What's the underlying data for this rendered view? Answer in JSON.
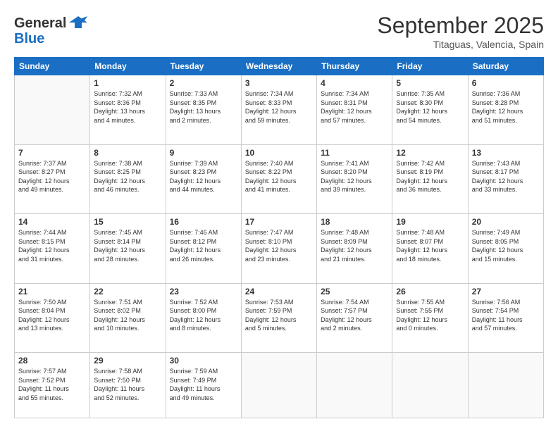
{
  "header": {
    "logo_general": "General",
    "logo_blue": "Blue",
    "month": "September 2025",
    "location": "Titaguas, Valencia, Spain"
  },
  "weekdays": [
    "Sunday",
    "Monday",
    "Tuesday",
    "Wednesday",
    "Thursday",
    "Friday",
    "Saturday"
  ],
  "weeks": [
    [
      {
        "day": "",
        "info": ""
      },
      {
        "day": "1",
        "info": "Sunrise: 7:32 AM\nSunset: 8:36 PM\nDaylight: 13 hours\nand 4 minutes."
      },
      {
        "day": "2",
        "info": "Sunrise: 7:33 AM\nSunset: 8:35 PM\nDaylight: 13 hours\nand 2 minutes."
      },
      {
        "day": "3",
        "info": "Sunrise: 7:34 AM\nSunset: 8:33 PM\nDaylight: 12 hours\nand 59 minutes."
      },
      {
        "day": "4",
        "info": "Sunrise: 7:34 AM\nSunset: 8:31 PM\nDaylight: 12 hours\nand 57 minutes."
      },
      {
        "day": "5",
        "info": "Sunrise: 7:35 AM\nSunset: 8:30 PM\nDaylight: 12 hours\nand 54 minutes."
      },
      {
        "day": "6",
        "info": "Sunrise: 7:36 AM\nSunset: 8:28 PM\nDaylight: 12 hours\nand 51 minutes."
      }
    ],
    [
      {
        "day": "7",
        "info": "Sunrise: 7:37 AM\nSunset: 8:27 PM\nDaylight: 12 hours\nand 49 minutes."
      },
      {
        "day": "8",
        "info": "Sunrise: 7:38 AM\nSunset: 8:25 PM\nDaylight: 12 hours\nand 46 minutes."
      },
      {
        "day": "9",
        "info": "Sunrise: 7:39 AM\nSunset: 8:23 PM\nDaylight: 12 hours\nand 44 minutes."
      },
      {
        "day": "10",
        "info": "Sunrise: 7:40 AM\nSunset: 8:22 PM\nDaylight: 12 hours\nand 41 minutes."
      },
      {
        "day": "11",
        "info": "Sunrise: 7:41 AM\nSunset: 8:20 PM\nDaylight: 12 hours\nand 39 minutes."
      },
      {
        "day": "12",
        "info": "Sunrise: 7:42 AM\nSunset: 8:19 PM\nDaylight: 12 hours\nand 36 minutes."
      },
      {
        "day": "13",
        "info": "Sunrise: 7:43 AM\nSunset: 8:17 PM\nDaylight: 12 hours\nand 33 minutes."
      }
    ],
    [
      {
        "day": "14",
        "info": "Sunrise: 7:44 AM\nSunset: 8:15 PM\nDaylight: 12 hours\nand 31 minutes."
      },
      {
        "day": "15",
        "info": "Sunrise: 7:45 AM\nSunset: 8:14 PM\nDaylight: 12 hours\nand 28 minutes."
      },
      {
        "day": "16",
        "info": "Sunrise: 7:46 AM\nSunset: 8:12 PM\nDaylight: 12 hours\nand 26 minutes."
      },
      {
        "day": "17",
        "info": "Sunrise: 7:47 AM\nSunset: 8:10 PM\nDaylight: 12 hours\nand 23 minutes."
      },
      {
        "day": "18",
        "info": "Sunrise: 7:48 AM\nSunset: 8:09 PM\nDaylight: 12 hours\nand 21 minutes."
      },
      {
        "day": "19",
        "info": "Sunrise: 7:48 AM\nSunset: 8:07 PM\nDaylight: 12 hours\nand 18 minutes."
      },
      {
        "day": "20",
        "info": "Sunrise: 7:49 AM\nSunset: 8:05 PM\nDaylight: 12 hours\nand 15 minutes."
      }
    ],
    [
      {
        "day": "21",
        "info": "Sunrise: 7:50 AM\nSunset: 8:04 PM\nDaylight: 12 hours\nand 13 minutes."
      },
      {
        "day": "22",
        "info": "Sunrise: 7:51 AM\nSunset: 8:02 PM\nDaylight: 12 hours\nand 10 minutes."
      },
      {
        "day": "23",
        "info": "Sunrise: 7:52 AM\nSunset: 8:00 PM\nDaylight: 12 hours\nand 8 minutes."
      },
      {
        "day": "24",
        "info": "Sunrise: 7:53 AM\nSunset: 7:59 PM\nDaylight: 12 hours\nand 5 minutes."
      },
      {
        "day": "25",
        "info": "Sunrise: 7:54 AM\nSunset: 7:57 PM\nDaylight: 12 hours\nand 2 minutes."
      },
      {
        "day": "26",
        "info": "Sunrise: 7:55 AM\nSunset: 7:55 PM\nDaylight: 12 hours\nand 0 minutes."
      },
      {
        "day": "27",
        "info": "Sunrise: 7:56 AM\nSunset: 7:54 PM\nDaylight: 11 hours\nand 57 minutes."
      }
    ],
    [
      {
        "day": "28",
        "info": "Sunrise: 7:57 AM\nSunset: 7:52 PM\nDaylight: 11 hours\nand 55 minutes."
      },
      {
        "day": "29",
        "info": "Sunrise: 7:58 AM\nSunset: 7:50 PM\nDaylight: 11 hours\nand 52 minutes."
      },
      {
        "day": "30",
        "info": "Sunrise: 7:59 AM\nSunset: 7:49 PM\nDaylight: 11 hours\nand 49 minutes."
      },
      {
        "day": "",
        "info": ""
      },
      {
        "day": "",
        "info": ""
      },
      {
        "day": "",
        "info": ""
      },
      {
        "day": "",
        "info": ""
      }
    ]
  ]
}
